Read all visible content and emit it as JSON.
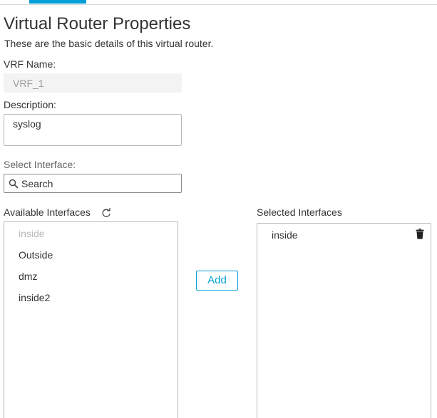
{
  "header": {
    "title": "Virtual Router Properties",
    "subtitle": "These are the basic details of this virtual router."
  },
  "vrf_name": {
    "label": "VRF Name:",
    "value": "VRF_1"
  },
  "description": {
    "label": "Description:",
    "value": "syslog"
  },
  "select_interface": {
    "label": "Select Interface:",
    "search_placeholder": "Search"
  },
  "available": {
    "label": "Available Interfaces",
    "items": [
      {
        "label": "inside",
        "disabled": true
      },
      {
        "label": "Outside",
        "disabled": false
      },
      {
        "label": "dmz",
        "disabled": false
      },
      {
        "label": "inside2",
        "disabled": false
      }
    ]
  },
  "actions": {
    "add_label": "Add"
  },
  "selected": {
    "label": "Selected Interfaces",
    "items": [
      {
        "label": "inside"
      }
    ]
  },
  "colors": {
    "accent": "#049fd9",
    "border": "#b9b9b9",
    "disabled_text": "#b9b9b9",
    "readonly_bg": "#f3f3f3"
  }
}
